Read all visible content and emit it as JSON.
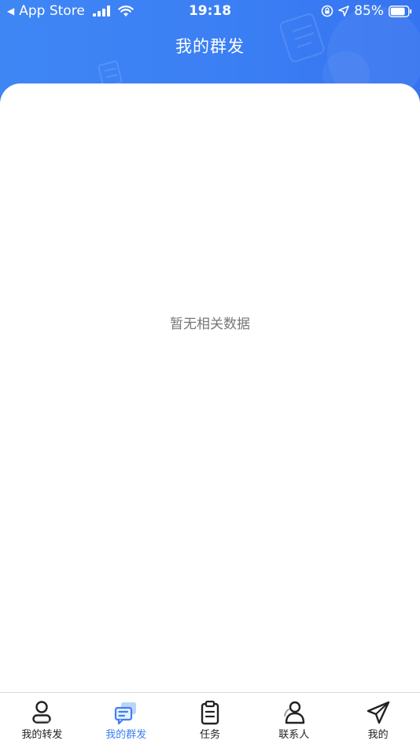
{
  "status_bar": {
    "back_glyph": "◀",
    "back_app": "App Store",
    "time": "19:18",
    "battery_percent": "85%",
    "battery_level": 0.85,
    "icons": [
      "cellular-signal-icon",
      "wifi-icon",
      "orientation-lock-icon",
      "location-icon",
      "battery-icon"
    ]
  },
  "header": {
    "title": "我的群发"
  },
  "main": {
    "empty_message": "暂无相关数据"
  },
  "tab_bar": {
    "items": [
      {
        "label": "我的转发",
        "icon": "person-icon",
        "active": false
      },
      {
        "label": "我的群发",
        "icon": "group-message-icon",
        "active": true
      },
      {
        "label": "任务",
        "icon": "clipboard-icon",
        "active": false
      },
      {
        "label": "联系人",
        "icon": "contacts-icon",
        "active": false
      },
      {
        "label": "我的",
        "icon": "paper-plane-icon",
        "active": false
      }
    ]
  },
  "colors": {
    "header_blue": "#3b7ff4",
    "active_tab": "#3d80f4",
    "inactive_tab": "#222222",
    "empty_text": "#777777"
  }
}
